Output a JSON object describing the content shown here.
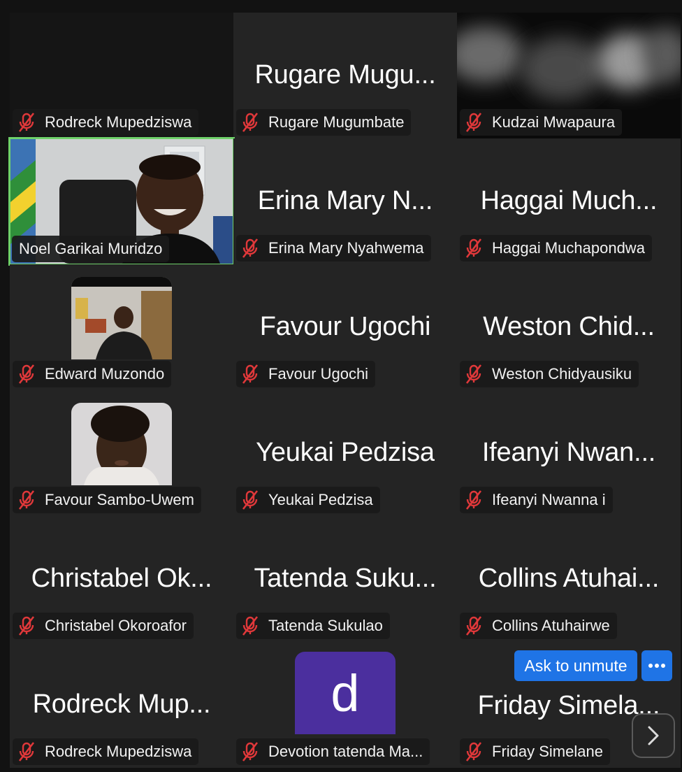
{
  "colors": {
    "mic_off": "#e0383a",
    "active_border": "#6fd16a",
    "accent_button": "#1f74e6"
  },
  "tiles": [
    {
      "big": "",
      "label": "Rodreck Mupedziswa",
      "kind": "dark"
    },
    {
      "big": "Rugare Mugu...",
      "label": "Rugare Mugumbate",
      "kind": "name"
    },
    {
      "big": "",
      "label": "Kudzai Mwapaura",
      "kind": "blurred-video"
    },
    {
      "big": "",
      "label": "Noel Garikai Muridzo",
      "kind": "video",
      "active": true
    },
    {
      "big": "Erina Mary N...",
      "label": "Erina Mary Nyahwema",
      "kind": "name"
    },
    {
      "big": "Haggai Much...",
      "label": "Haggai Muchapondwa",
      "kind": "name"
    },
    {
      "big": "",
      "label": "Edward Muzondo",
      "kind": "photo"
    },
    {
      "big": "Favour Ugochi",
      "label": "Favour Ugochi",
      "kind": "name"
    },
    {
      "big": "Weston Chid...",
      "label": "Weston Chidyausiku",
      "kind": "name"
    },
    {
      "big": "",
      "label": "Favour Sambo-Uwem",
      "kind": "photo"
    },
    {
      "big": "Yeukai Pedzisa",
      "label": "Yeukai Pedzisa",
      "kind": "name"
    },
    {
      "big": "Ifeanyi Nwan...",
      "label": "Ifeanyi Nwanna i",
      "kind": "name"
    },
    {
      "big": "Christabel Ok...",
      "label": "Christabel Okoroafor",
      "kind": "name"
    },
    {
      "big": "Tatenda Suku...",
      "label": "Tatenda Sukulao",
      "kind": "name"
    },
    {
      "big": "Collins Atuhai...",
      "label": "Collins Atuhairwe",
      "kind": "name"
    },
    {
      "big": "Rodreck Mup...",
      "label": "Rodreck Mupedziswa",
      "kind": "name"
    },
    {
      "big": "",
      "label": "Devotion tatenda Ma...",
      "kind": "letter",
      "letter": "d"
    },
    {
      "big": "Friday Simela...",
      "label": "Friday Simelane",
      "kind": "name"
    }
  ],
  "controls": {
    "ask_to_unmute": "Ask to unmute",
    "more_icon": "ellipsis-icon",
    "next_icon": "chevron-right-icon"
  },
  "icons": {
    "mic": "mic-muted-icon"
  }
}
